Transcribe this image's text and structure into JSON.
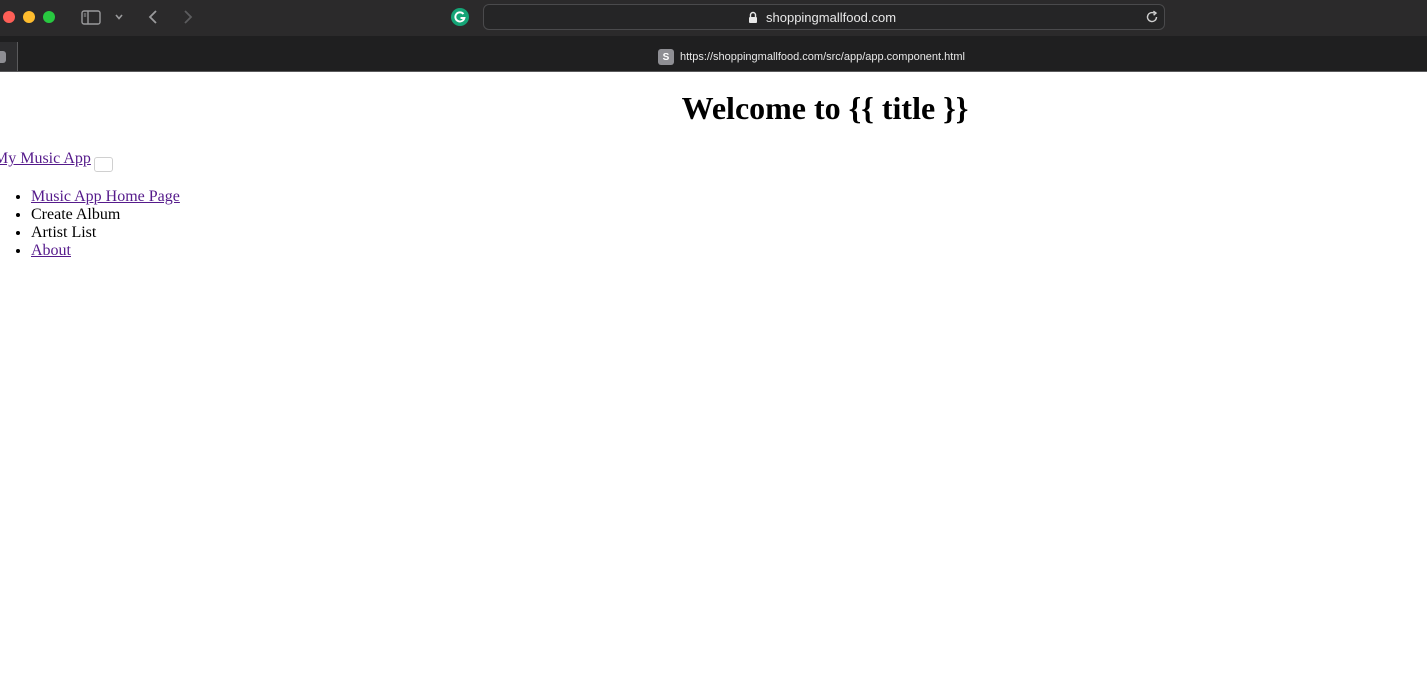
{
  "browser": {
    "address_bar": "shoppingmallfood.com",
    "tab_url": "https://shoppingmallfood.com/src/app/app.component.html",
    "tab_favicon_letter": "S"
  },
  "page": {
    "heading": "Welcome to {{ title }}",
    "brand": "My Music App",
    "nav_items": [
      {
        "label": "Music App Home Page"
      },
      {
        "label": "Create Album"
      },
      {
        "label": "Artist List"
      },
      {
        "label": "About"
      }
    ]
  },
  "colors": {
    "link_visited": "#551a8b",
    "chrome_dark": "#2b2a2b"
  }
}
